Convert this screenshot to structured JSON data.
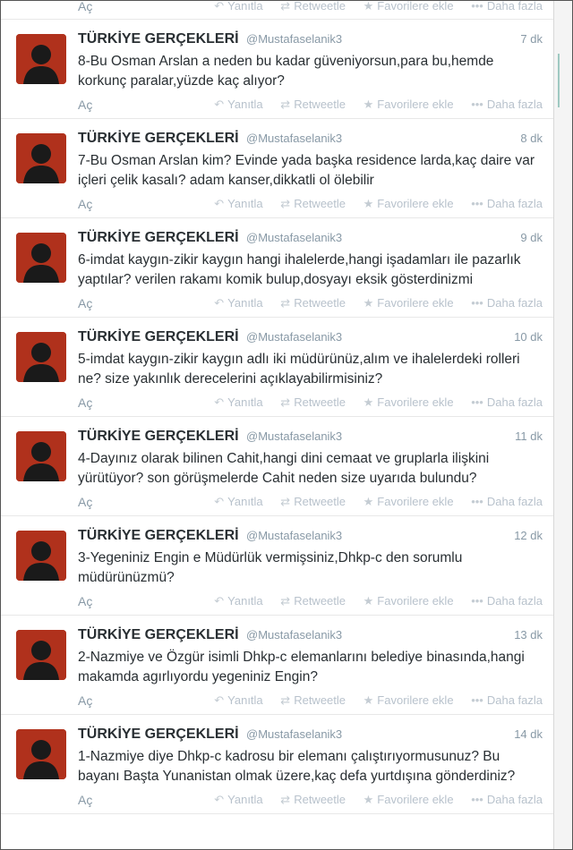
{
  "common": {
    "full_name": "TÜRKİYE GERÇEKLERİ",
    "username": "@Mustafaselanik3",
    "expand_label": "Aç",
    "reply_label": "Yanıtla",
    "retweet_label": "Retweetle",
    "favorite_label": "Favorilere ekle",
    "more_label": "Daha fazla",
    "icons": {
      "reply": "reply-icon",
      "retweet": "retweet-icon",
      "favorite": "star-icon",
      "more": "more-dots-icon"
    }
  },
  "colors": {
    "avatar_bg": "#b0311c",
    "name": "#292f33",
    "muted": "#8899a6",
    "action": "#b8c2cc"
  },
  "tweets": [
    {
      "time": "7 dk",
      "text": "8-Bu Osman Arslan a neden bu kadar güveniyorsun,para bu,hemde korkunç paralar,yüzde kaç alıyor?"
    },
    {
      "time": "8 dk",
      "text": "7-Bu Osman Arslan kim? Evinde yada başka residence larda,kaç daire var içleri çelik kasalı? adam kanser,dikkatli ol ölebilir"
    },
    {
      "time": "9 dk",
      "text": "6-imdat kaygın-zikir kaygın hangi ihalelerde,hangi işadamları ile pazarlık yaptılar? verilen rakamı komik bulup,dosyayı eksik gösterdinizmi"
    },
    {
      "time": "10 dk",
      "text": "5-imdat kaygın-zikir kaygın adlı iki müdürünüz,alım ve ihalelerdeki rolleri ne? size yakınlık derecelerini açıklayabilirmisiniz?"
    },
    {
      "time": "11 dk",
      "text": "4-Dayınız olarak bilinen Cahit,hangi dini cemaat ve gruplarla ilişkini yürütüyor? son görüşmelerde Cahit neden size uyarıda bulundu?"
    },
    {
      "time": "12 dk",
      "text": "3-Yegeniniz Engin e Müdürlük vermişsiniz,Dhkp-c den sorumlu müdürünüzmü?"
    },
    {
      "time": "13 dk",
      "text": "2-Nazmiye ve Özgür isimli Dhkp-c elemanlarını belediye binasında,hangi makamda agırlıyordu yegeniniz Engin?"
    },
    {
      "time": "14 dk",
      "text": "1-Nazmiye diye Dhkp-c kadrosu bir elemanı çalıştırıyormusunuz? Bu bayanı Başta Yunanistan olmak üzere,kaç defa yurtdışına gönderdiniz?"
    }
  ]
}
